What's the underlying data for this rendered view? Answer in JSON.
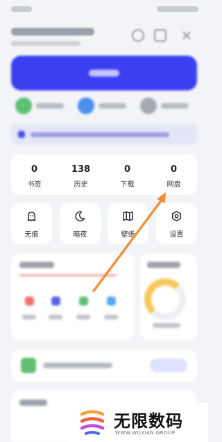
{
  "stats": [
    {
      "value": "0",
      "label": "书签"
    },
    {
      "value": "138",
      "label": "历史"
    },
    {
      "value": "0",
      "label": "下载"
    },
    {
      "value": "0",
      "label": "网盘"
    }
  ],
  "quick_actions": [
    {
      "label": "无痕",
      "icon": "ghost-icon"
    },
    {
      "label": "暗夜",
      "icon": "moon-icon"
    },
    {
      "label": "壁纸",
      "icon": "map-icon"
    },
    {
      "label": "设置",
      "icon": "hexagon-settings-icon"
    }
  ],
  "watermark": {
    "title": "无限数码",
    "subtitle": "WWW.WUXIAN.GROUP"
  },
  "colors": {
    "banner": "#3b3ff0",
    "arrow": "#f0913a",
    "background": "#f3f4f7"
  }
}
